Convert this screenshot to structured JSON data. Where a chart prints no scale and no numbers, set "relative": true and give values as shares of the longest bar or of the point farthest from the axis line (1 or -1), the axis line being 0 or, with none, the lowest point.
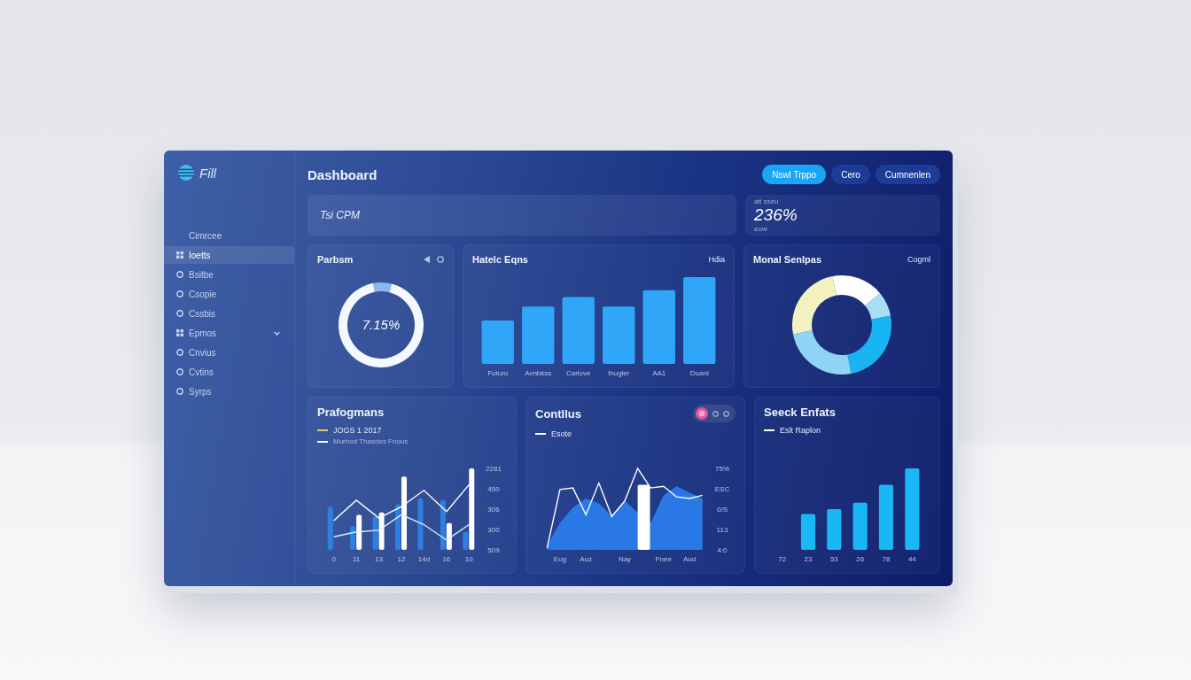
{
  "sidebar": {
    "logo": "Fill",
    "items": [
      {
        "label": "Cimrcee",
        "kind": "plain",
        "selected": false,
        "collapsible": false
      },
      {
        "label": "Ioetts",
        "kind": "group",
        "selected": true,
        "collapsible": false
      },
      {
        "label": "Bsitbe",
        "kind": "link",
        "selected": false,
        "collapsible": false
      },
      {
        "label": "Csopie",
        "kind": "link",
        "selected": false,
        "collapsible": false
      },
      {
        "label": "Cssbis",
        "kind": "link",
        "selected": false,
        "collapsible": false
      },
      {
        "label": "Epmos",
        "kind": "group",
        "selected": false,
        "collapsible": true
      },
      {
        "label": "Cnvius",
        "kind": "link",
        "selected": false,
        "collapsible": false
      },
      {
        "label": "Cvtins",
        "kind": "link",
        "selected": false,
        "collapsible": false
      },
      {
        "label": "Syrps",
        "kind": "link",
        "selected": false,
        "collapsible": false
      }
    ]
  },
  "header": {
    "title": "Dashboard",
    "buttons": [
      {
        "label": "Nswl Trppo",
        "kind": "primary"
      },
      {
        "label": "Cero",
        "kind": "secondary"
      },
      {
        "label": "Cumnenlen",
        "kind": "secondary"
      }
    ]
  },
  "banner": {
    "text": "Tsi CPM"
  },
  "kpi": {
    "label": "ati sseu",
    "value": "236%",
    "note": "eow"
  },
  "overview_cards": [
    {
      "title": "Parbsm",
      "toolbar": true,
      "center_label": "7.15%",
      "chart_data": {
        "type": "donut",
        "values": [
          7,
          93
        ],
        "colors": [
          "#8fb6ec",
          "#f4f8ff"
        ]
      }
    },
    {
      "title": "Hatelc Eqns",
      "aside": "Hdia",
      "toolbar": false,
      "chart_data": {
        "type": "bar",
        "categories": [
          "Futuro",
          "Avnbkss",
          "Carlove",
          "Ihugler",
          "AA1",
          "Duanl"
        ],
        "relative": true,
        "series": [
          {
            "color": "#2fa6f8",
            "values": [
              0.5,
              0.66,
              0.77,
              0.66,
              0.85,
              1
            ]
          }
        ]
      }
    },
    {
      "title": "Monal Senlpas",
      "aside": "Cogml",
      "toolbar": false,
      "chart_data": {
        "type": "donut",
        "values": [
          17,
          8,
          25,
          25,
          25
        ],
        "colors": [
          "#ffffff",
          "#a9def7",
          "#19b4f2",
          "#8fd3f5",
          "#f4f1c1"
        ]
      }
    }
  ],
  "detail_cards": [
    {
      "kind": "combo",
      "title": "Prafogmans",
      "legend": [
        {
          "label": "JOGS 1 2017",
          "color": "#e8c66a"
        },
        {
          "label": "Murbod Thasdes Fnous",
          "color": "#ffffff"
        }
      ],
      "x_labels": [
        "0",
        "11",
        "13",
        "12",
        "14d",
        "16",
        "10"
      ],
      "y_labels": [
        "2281",
        "450",
        "306",
        "300",
        "509"
      ]
    },
    {
      "kind": "area",
      "title": "Contllus",
      "switch": {
        "on": true
      },
      "legend": [
        {
          "label": "Esote",
          "color": "#ffffff"
        }
      ],
      "x_labels": [
        "Eug",
        "Auz",
        "Nay",
        "Fnee",
        "Aud"
      ],
      "y_labels": [
        "75%",
        "ESC",
        "0/S",
        "113",
        "4:0"
      ]
    },
    {
      "kind": "chart",
      "title": "Seeck Enfats",
      "legend": [
        {
          "label": "Eslt Raplon",
          "color": "#ffffff"
        }
      ],
      "chart_data": {
        "type": "bar",
        "categories": [
          "72",
          "23",
          "53",
          "26",
          "78",
          "44"
        ],
        "relative": true,
        "series": [
          {
            "color": "#19b8f5",
            "values": [
              null,
              0.44,
              0.5,
              0.58,
              0.8,
              1
            ]
          }
        ]
      }
    }
  ]
}
